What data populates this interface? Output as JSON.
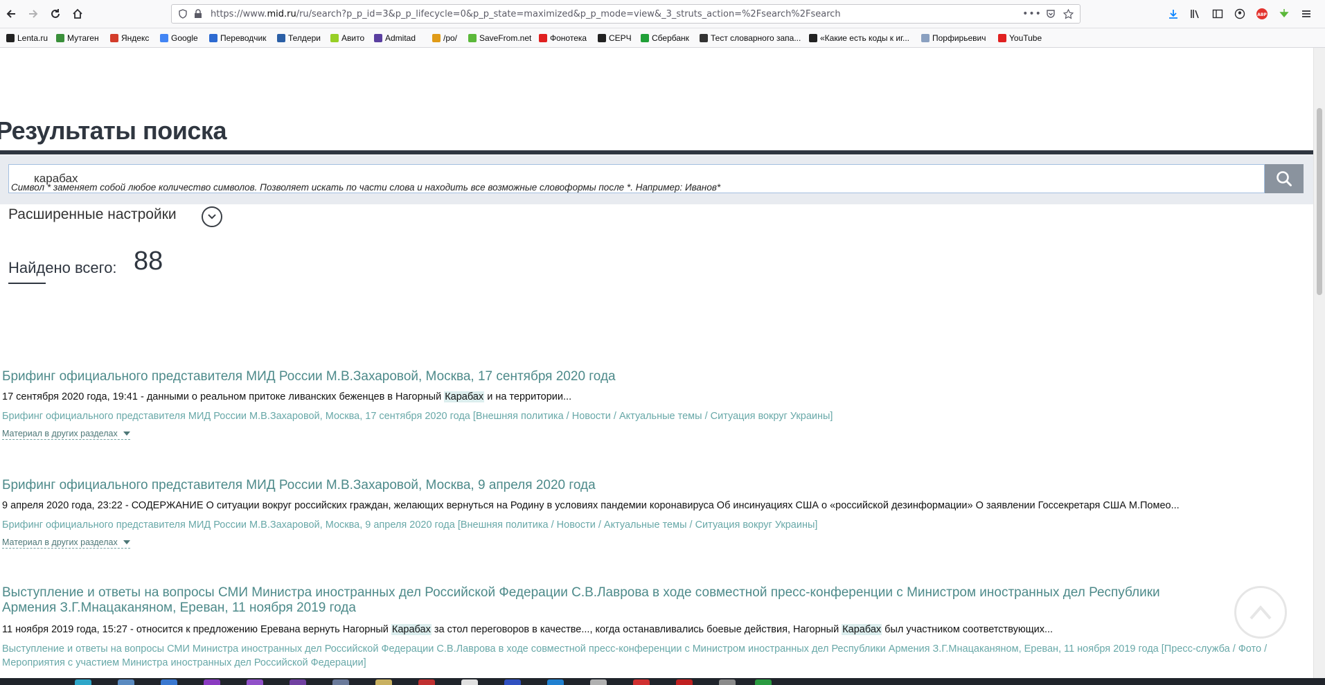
{
  "browser": {
    "url_prefix": "https://www.",
    "url_domain": "mid.ru",
    "url_rest": "/ru/search?p_p_id=3&p_p_lifecycle=0&p_p_state=maximized&p_p_mode=view&_3_struts_action=%2Fsearch%2Fsearch",
    "bookmarks": [
      {
        "label": "Lenta.ru",
        "color": "#222222"
      },
      {
        "label": "Мутаген",
        "color": "#3a8f3a"
      },
      {
        "label": "Яндекс",
        "color": "#d33c2b"
      },
      {
        "label": "Google",
        "color": "#4285f4"
      },
      {
        "label": "Переводчик",
        "color": "#2d6ad1"
      },
      {
        "label": "Телдери",
        "color": "#2b5fa6"
      },
      {
        "label": "Авито",
        "color": "#97cf26"
      },
      {
        "label": "Admitad",
        "color": "#5a3fa0"
      },
      {
        "label": "/po/",
        "color": "#e09b18"
      },
      {
        "label": "SaveFrom.net",
        "color": "#5bb83a"
      },
      {
        "label": "Фонотека",
        "color": "#e02020"
      },
      {
        "label": "СЕРЧ",
        "color": "#222222"
      },
      {
        "label": "Сбербанк",
        "color": "#21a038"
      },
      {
        "label": "Тест словарного запа...",
        "color": "#333333"
      },
      {
        "label": "«Какие есть коды к иг...",
        "color": "#222222"
      },
      {
        "label": "Порфирьевич",
        "color": "#8aa0c0"
      },
      {
        "label": "YouTube",
        "color": "#e02020"
      }
    ]
  },
  "page": {
    "title": "Результаты поиска",
    "search_value": "карабах",
    "hint": "Символ * заменяет собой любое количество символов. Позволяет искать по части слова и находить все возможные словоформы после *. Например: Иванов*",
    "advanced_label": "Расширенные настройки",
    "found_label": "Найдено всего:",
    "found_count": "88"
  },
  "results": [
    {
      "title": "Брифинг официального представителя МИД России М.В.Захаровой, Москва, 17 сентября 2020 года",
      "snippet_a": "17 сентября 2020 года, 19:41 - данными о реальном притоке ливанских беженцев в Нагорный ",
      "snippet_hl1": "Карабах",
      "snippet_b": " и на территории...",
      "path": "Брифинг официального представителя МИД России М.В.Захаровой, Москва, 17 сентября 2020 года [Внешняя политика / Новости / Актуальные темы / Ситуация вокруг Украины]",
      "more": "Материал в других разделах"
    },
    {
      "title": "Брифинг официального представителя МИД России М.В.Захаровой, Москва, 9 апреля 2020 года",
      "snippet_a": "9 апреля 2020 года, 23:22 - СОДЕРЖАНИЕ О ситуации вокруг российских граждан, желающих вернуться на Родину в условиях пандемии коронавируса Об инсинуациях США о «российской дезинформации» О заявлении Госсекретаря США М.Помео...",
      "path": "Брифинг официального представителя МИД России М.В.Захаровой, Москва, 9 апреля 2020 года [Внешняя политика / Новости / Актуальные темы / Ситуация вокруг Украины]",
      "more": "Материал в других разделах"
    },
    {
      "title": "Выступление и ответы на вопросы СМИ Министра иностранных дел Российской Федерации С.В.Лаврова в ходе совместной пресс-конференции с Министром иностранных дел Республики Армения З.Г.Мнацаканяном, Ереван, 11 ноября 2019 года",
      "snippet_a": "11 ноября 2019 года, 15:27 - относится к предложению Еревана вернуть Нагорный ",
      "snippet_hl1": "Карабах",
      "snippet_b": " за стол переговоров в качестве..., когда останавливались боевые действия, Нагорный ",
      "snippet_hl2": "Карабах",
      "snippet_c": " был участником соответствующих...",
      "path": "Выступление и ответы на вопросы СМИ Министра иностранных дел Российской Федерации С.В.Лаврова в ходе совместной пресс-конференции с Министром иностранных дел Республики Армения З.Г.Мнацаканяном, Ереван, 11 ноября 2019 года [Пресс-служба / Фото / Мероприятия с участием Министра иностранных дел Российской Федерации]"
    }
  ]
}
